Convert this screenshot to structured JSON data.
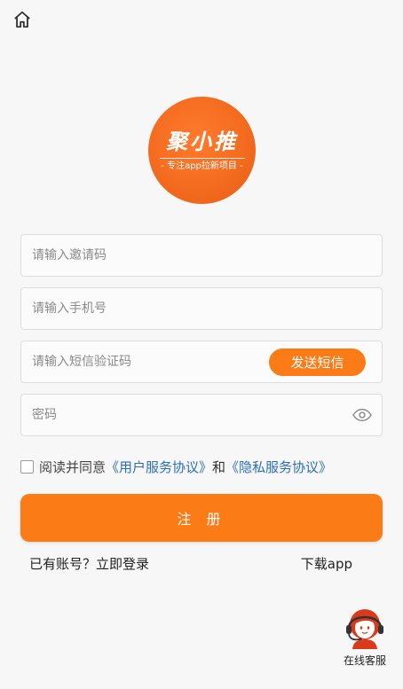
{
  "home": {
    "icon": "home-icon"
  },
  "logo": {
    "name": "聚小推",
    "slogan": "- 专注app拉新项目 -",
    "color": "#f26a1e"
  },
  "form": {
    "invite_code": {
      "placeholder": "请输入邀请码",
      "value": ""
    },
    "phone": {
      "placeholder": "请输入手机号",
      "value": ""
    },
    "sms_code": {
      "placeholder": "请输入短信验证码",
      "value": ""
    },
    "send_sms_label": "发送短信",
    "password": {
      "placeholder": "密码",
      "value": "",
      "toggle_icon": "eye-icon"
    }
  },
  "agreement": {
    "checked": false,
    "prefix": "阅读并同意",
    "user_agreement": "《用户服务协议》",
    "and": "和",
    "privacy_agreement": "《隐私服务协议》"
  },
  "register_label": "注 册",
  "login_link": "已有账号？立即登录",
  "download_link": "下载app",
  "customer_service": {
    "label": "在线客服",
    "icon": "customer-service-icon"
  },
  "colors": {
    "accent": "#fb7b16",
    "link": "#2b6fb8",
    "background": "#f7f7f7"
  }
}
